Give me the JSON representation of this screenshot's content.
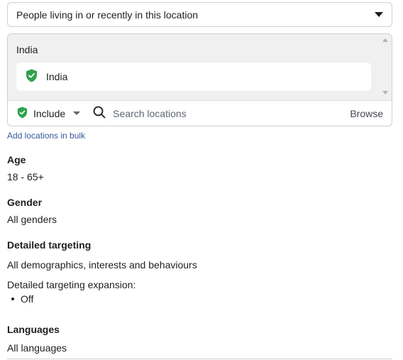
{
  "location_type": {
    "selected": "People living in or recently in this location"
  },
  "locations": {
    "group_header": "India",
    "items": [
      {
        "label": "India",
        "status": "included"
      }
    ],
    "include_label": "Include",
    "search_placeholder": "Search locations",
    "browse_label": "Browse",
    "bulk_link": "Add locations in bulk"
  },
  "age": {
    "title": "Age",
    "value": "18 - 65+"
  },
  "gender": {
    "title": "Gender",
    "value": "All genders"
  },
  "detailed_targeting": {
    "title": "Detailed targeting",
    "value": "All demographics, interests and behaviours",
    "expansion_label": "Detailed targeting expansion:",
    "expansion_value": "Off"
  },
  "languages": {
    "title": "Languages",
    "value": "All languages"
  },
  "colors": {
    "include_green": "#31a24c",
    "link_blue": "#385898",
    "list_bg": "#f0f0f0"
  }
}
